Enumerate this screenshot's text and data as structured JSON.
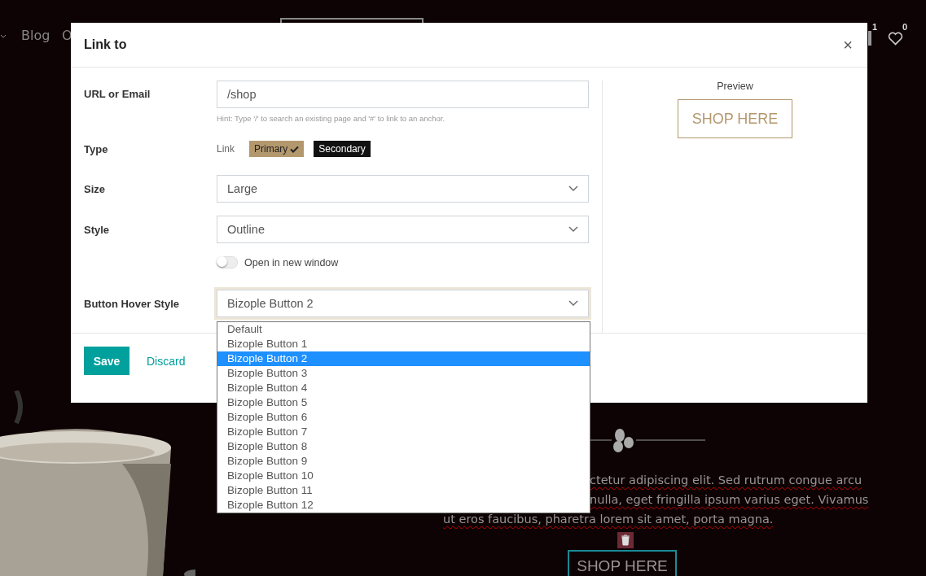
{
  "site_nav": {
    "items": [
      "Blog",
      "O"
    ],
    "cart_count": "1",
    "wishlist_count": "0"
  },
  "dialog": {
    "title": "Link to",
    "close": "×",
    "url": {
      "label": "URL or Email",
      "value": "/shop",
      "hint": "Hint: Type '/' to search an existing page and '#' to link to an anchor."
    },
    "type": {
      "label": "Type",
      "options": [
        {
          "label": "Link",
          "kind": "link",
          "selected": false
        },
        {
          "label": "Primary",
          "kind": "primary",
          "selected": true
        },
        {
          "label": "Secondary",
          "kind": "secondary",
          "selected": false
        }
      ]
    },
    "size": {
      "label": "Size",
      "value": "Large"
    },
    "style": {
      "label": "Style",
      "value": "Outline"
    },
    "new_window": {
      "label": "Open in new window",
      "on": false
    },
    "hover_style": {
      "label": "Button Hover Style",
      "value": "Bizople Button 2"
    },
    "preview": {
      "title": "Preview",
      "button": "SHOP HERE"
    },
    "buttons": {
      "save": "Save",
      "discard": "Discard"
    }
  },
  "dropdown": [
    {
      "label": "Default",
      "selected": false
    },
    {
      "label": "Bizople Button 1",
      "selected": false
    },
    {
      "label": "Bizople Button 2",
      "selected": true
    },
    {
      "label": "Bizople Button 3",
      "selected": false
    },
    {
      "label": "Bizople Button 4",
      "selected": false
    },
    {
      "label": "Bizople Button 5",
      "selected": false
    },
    {
      "label": "Bizople Button 6",
      "selected": false
    },
    {
      "label": "Bizople Button 7",
      "selected": false
    },
    {
      "label": "Bizople Button 8",
      "selected": false
    },
    {
      "label": "Bizople Button 9",
      "selected": false
    },
    {
      "label": "Bizople Button 10",
      "selected": false
    },
    {
      "label": "Bizople Button 11",
      "selected": false
    },
    {
      "label": "Bizople Button 12",
      "selected": false
    }
  ],
  "page": {
    "text_lines": [
      "ctetur adipiscing elit. Sed rutrum congue arcu",
      "nulla, eget fringilla ipsum varius eget. Vivamus",
      "ut eros faucibus, pharetra lorem sit amet, porta magna."
    ],
    "button": "SHOP HERE"
  }
}
